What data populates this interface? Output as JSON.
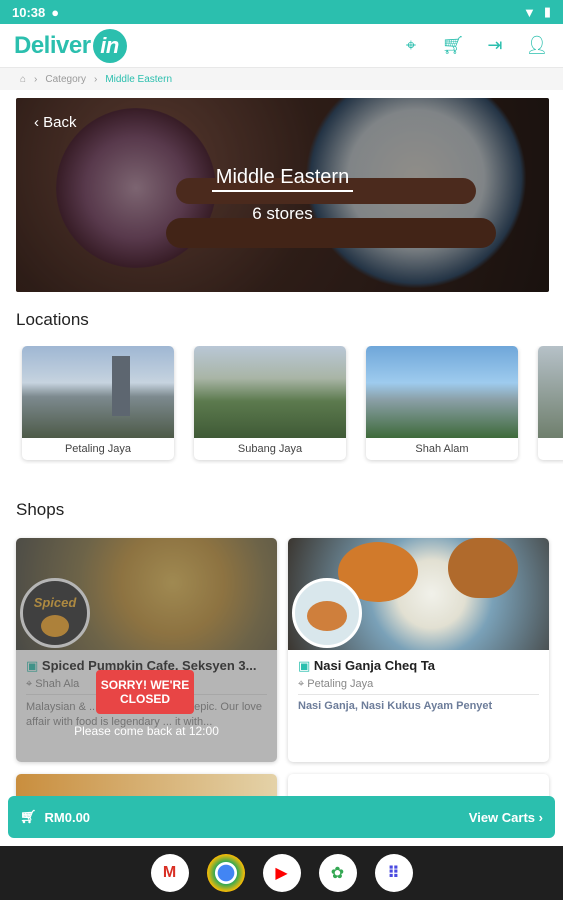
{
  "status": {
    "time": "10:38"
  },
  "header": {
    "logo_text": "Deliver",
    "logo_in": "in"
  },
  "breadcrumb": {
    "category": "Category",
    "current": "Middle Eastern"
  },
  "hero": {
    "back": "Back",
    "title": "Middle Eastern",
    "count": "6 stores"
  },
  "sections": {
    "locations": "Locations",
    "shops": "Shops"
  },
  "locations": [
    {
      "label": "Petaling Jaya"
    },
    {
      "label": "Subang Jaya"
    },
    {
      "label": "Shah Alam"
    }
  ],
  "shops": [
    {
      "name": "Spiced Pumpkin Cafe, Seksyen 3...",
      "location": "Shah Ala",
      "description": "Malaysian & ... ory in making food epic. Our love affair with food is legendary ... it with...",
      "closed_title": "SORRY! WE'RE CLOSED",
      "closed_message": "Please come back at 12:00",
      "badge_text": "Spiced"
    },
    {
      "name": "Nasi Ganja Cheq Ta",
      "location": "Petaling Jaya",
      "tags": "Nasi Ganja, Nasi Kukus Ayam Penyet"
    }
  ],
  "cart": {
    "total": "RM0.00",
    "view": "View Carts"
  },
  "colors": {
    "accent": "#2bbfae",
    "closed": "#e84545"
  }
}
